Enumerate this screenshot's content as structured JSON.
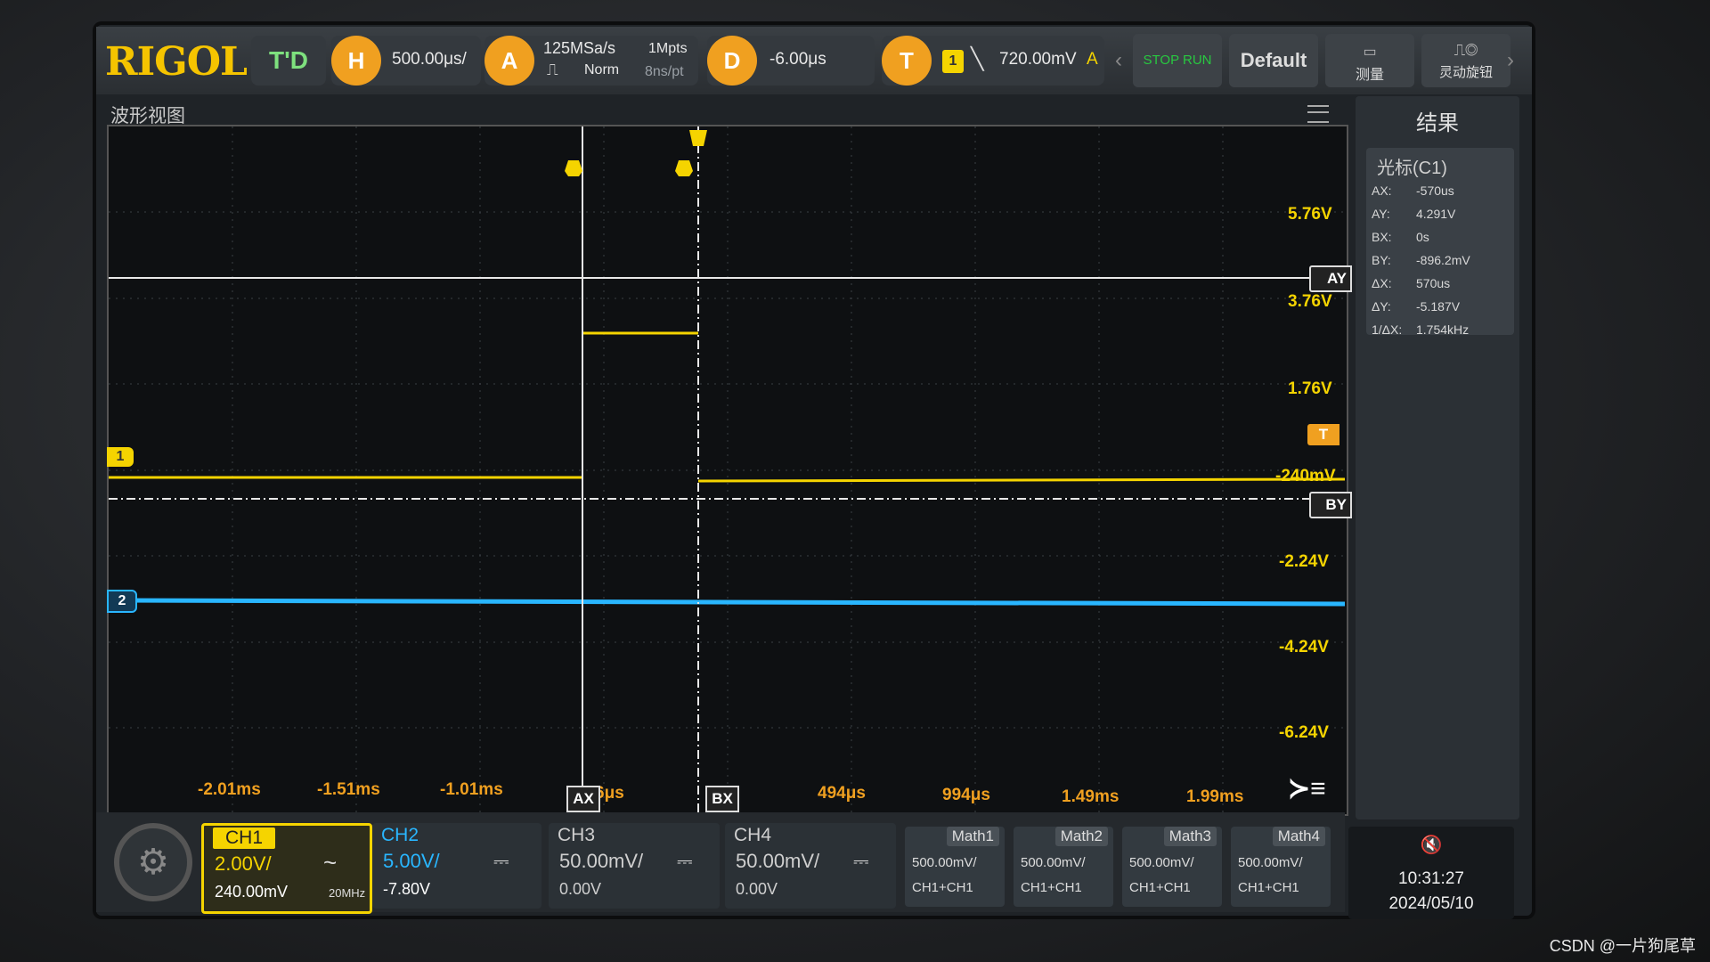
{
  "brand": "RIGOL",
  "status": "T'D",
  "horizontal": {
    "badge": "H",
    "timebase": "500.00μs/"
  },
  "acquire": {
    "badge": "A",
    "sample_rate": "125MSa/s",
    "mode": "Norm",
    "depth": "1Mpts",
    "per_point": "8ns/pt"
  },
  "delay": {
    "badge": "D",
    "value": "-6.00μs"
  },
  "trigger": {
    "badge": "T",
    "source": "1",
    "level": "720.00mV",
    "mode": "A"
  },
  "buttons": {
    "stop_run": "STOP RUN",
    "default": "Default",
    "measure": "测量",
    "flex_knob": "灵动旋钮"
  },
  "waveform": {
    "title": "波形视图",
    "volt_labels": [
      "5.76V",
      "3.76V",
      "1.76V",
      "-240mV",
      "-2.24V",
      "-4.24V",
      "-6.24V"
    ],
    "time_labels": [
      "-2.01ms",
      "-1.51ms",
      "-1.01ms",
      "6μs",
      "494μs",
      "994μs",
      "1.49ms",
      "1.99ms"
    ],
    "markers": {
      "ay": "AY",
      "by": "BY",
      "ax": "AX",
      "bx": "BX",
      "trig": "T",
      "ch1": "1",
      "ch2": "2"
    }
  },
  "results": {
    "title": "结果",
    "cursor_head": "光标(C1)",
    "rows": [
      {
        "k": "AX:",
        "v": "-570us"
      },
      {
        "k": "AY:",
        "v": "4.291V"
      },
      {
        "k": "BX:",
        "v": "0s"
      },
      {
        "k": "BY:",
        "v": "-896.2mV"
      },
      {
        "k": "ΔX:",
        "v": "570us"
      },
      {
        "k": "ΔY:",
        "v": "-5.187V"
      },
      {
        "k": "1/ΔX:",
        "v": "1.754kHz"
      }
    ]
  },
  "channels": [
    {
      "name": "CH1",
      "scale": "2.00V/",
      "coupling": "~",
      "offset": "240.00mV",
      "bw": "20MHz",
      "color": "#f5d400"
    },
    {
      "name": "CH2",
      "scale": "5.00V/",
      "coupling": "⎓",
      "offset": "-7.80V",
      "color": "#29b6ff"
    },
    {
      "name": "CH3",
      "scale": "50.00mV/",
      "coupling": "⎓",
      "offset": "0.00V",
      "color": "#cfcfcf"
    },
    {
      "name": "CH4",
      "scale": "50.00mV/",
      "coupling": "⎓",
      "offset": "0.00V",
      "color": "#cfcfcf"
    }
  ],
  "maths": [
    {
      "name": "Math1",
      "scale": "500.00mV/",
      "src": "CH1+CH1"
    },
    {
      "name": "Math2",
      "scale": "500.00mV/",
      "src": "CH1+CH1"
    },
    {
      "name": "Math3",
      "scale": "500.00mV/",
      "src": "CH1+CH1"
    },
    {
      "name": "Math4",
      "scale": "500.00mV/",
      "src": "CH1+CH1"
    }
  ],
  "clock": {
    "time": "10:31:27",
    "date": "2024/05/10"
  },
  "watermark": "CSDN @一片狗尾草"
}
